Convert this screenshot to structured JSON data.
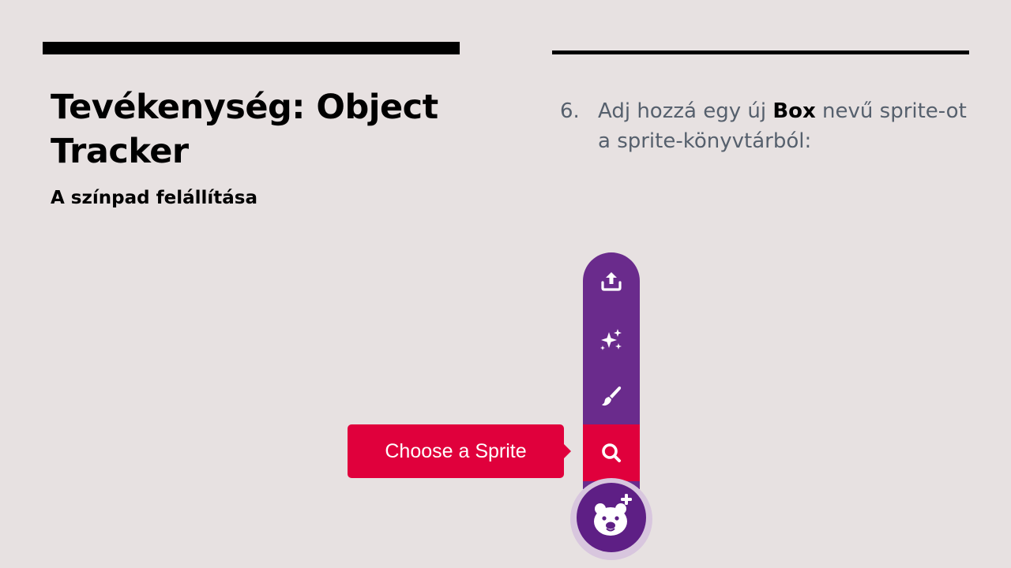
{
  "slide": {
    "title": "Tevékenység: Object Tracker",
    "subtitle": "A színpad felállítása"
  },
  "instruction": {
    "number": "6.",
    "text_before": "Adj hozzá egy új ",
    "highlight": "Box",
    "text_after": " nevű sprite-ot a sprite-könyvtárból:"
  },
  "sprite_menu": {
    "tooltip_label": "Choose a Sprite",
    "items": [
      {
        "icon": "upload-icon"
      },
      {
        "icon": "surprise-sparkles-icon"
      },
      {
        "icon": "paint-brush-icon"
      },
      {
        "icon": "search-icon",
        "active": true
      }
    ],
    "main_button_icon": "bear-plus-icon"
  },
  "colors": {
    "background": "#e7e1e1",
    "menu_purple": "#6a2b8c",
    "active_red": "#e0003c",
    "text_gray": "#56606d"
  }
}
